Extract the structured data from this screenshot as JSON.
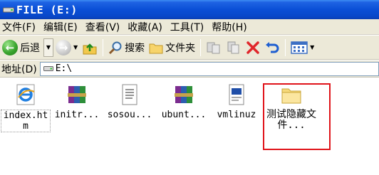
{
  "window": {
    "title": "FILE (E:)"
  },
  "menu": [
    {
      "label": "文件(F)"
    },
    {
      "label": "编辑(E)"
    },
    {
      "label": "查看(V)"
    },
    {
      "label": "收藏(A)"
    },
    {
      "label": "工具(T)"
    },
    {
      "label": "帮助(H)"
    }
  ],
  "toolbar": {
    "back_label": "后退",
    "search_label": "搜索",
    "folders_label": "文件夹"
  },
  "address": {
    "label": "地址(D)",
    "value": "E:\\"
  },
  "files": [
    {
      "name": "index.htm",
      "icon": "ie-html-icon"
    },
    {
      "name": "initr...",
      "icon": "winrar-archive-icon"
    },
    {
      "name": "sosou...",
      "icon": "text-document-icon"
    },
    {
      "name": "ubunt...",
      "icon": "winrar-archive-icon"
    },
    {
      "name": "vmlinuz",
      "icon": "system-file-icon"
    },
    {
      "name": "测试隐藏文件...",
      "icon": "folder-icon"
    }
  ],
  "colors": {
    "titlebar": "#0a4fd6",
    "chrome": "#ece9d8",
    "highlight": "#e0131a"
  }
}
